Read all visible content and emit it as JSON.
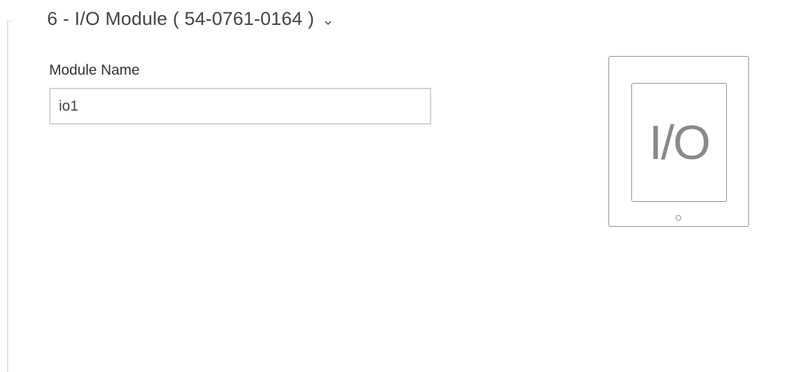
{
  "section": {
    "title": "6 - I/O Module ( 54-0761-0164 )",
    "expand_icon": "chevron-down-icon"
  },
  "module_name": {
    "label": "Module Name",
    "value": "io1"
  },
  "device_image": {
    "screen_text": "I/O",
    "icon": "device-module-icon"
  }
}
